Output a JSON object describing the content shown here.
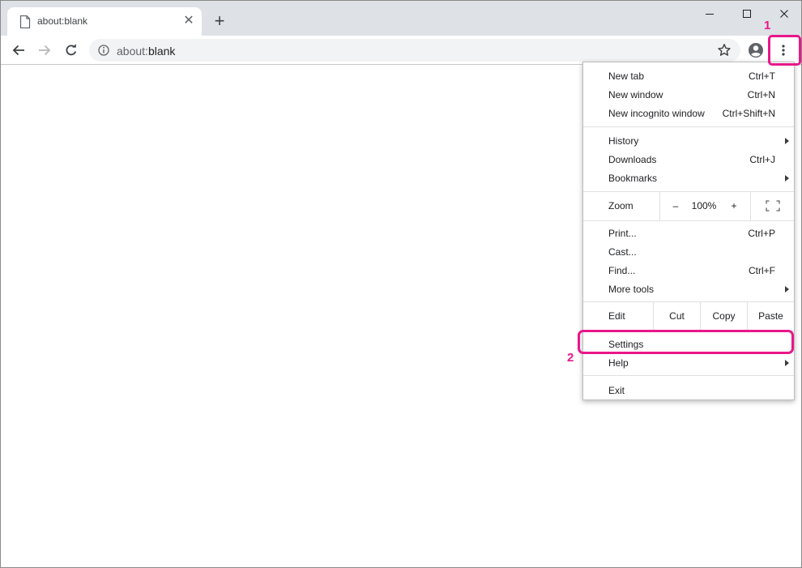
{
  "tab": {
    "title": "about:blank",
    "close_glyph": "✕",
    "new_tab_glyph": "+"
  },
  "address": {
    "scheme_dim": "about:",
    "path": "blank"
  },
  "menu": {
    "group1": [
      {
        "label": "New tab",
        "accel": "Ctrl+T"
      },
      {
        "label": "New window",
        "accel": "Ctrl+N"
      },
      {
        "label": "New incognito window",
        "accel": "Ctrl+Shift+N"
      }
    ],
    "group2": [
      {
        "label": "History",
        "accel": "",
        "submenu": true
      },
      {
        "label": "Downloads",
        "accel": "Ctrl+J"
      },
      {
        "label": "Bookmarks",
        "accel": "",
        "submenu": true
      }
    ],
    "zoom": {
      "label": "Zoom",
      "minus": "–",
      "value": "100%",
      "plus": "+"
    },
    "group3": [
      {
        "label": "Print...",
        "accel": "Ctrl+P"
      },
      {
        "label": "Cast...",
        "accel": ""
      },
      {
        "label": "Find...",
        "accel": "Ctrl+F"
      },
      {
        "label": "More tools",
        "accel": "",
        "submenu": true
      }
    ],
    "edit": {
      "label": "Edit",
      "cut": "Cut",
      "copy": "Copy",
      "paste": "Paste"
    },
    "group4": [
      {
        "label": "Settings",
        "accel": ""
      },
      {
        "label": "Help",
        "accel": "",
        "submenu": true
      }
    ],
    "exit": {
      "label": "Exit"
    }
  },
  "annotations": {
    "step1": "1",
    "step2": "2",
    "color": "#e8178a"
  },
  "icons": [
    "page-icon",
    "close-icon",
    "plus-icon",
    "minimize-icon",
    "maximize-icon",
    "window-close-icon",
    "back-arrow-icon",
    "forward-arrow-icon",
    "reload-icon",
    "info-icon",
    "star-icon",
    "profile-icon",
    "kebab-menu-icon",
    "fullscreen-icon",
    "submenu-arrow-icon"
  ]
}
